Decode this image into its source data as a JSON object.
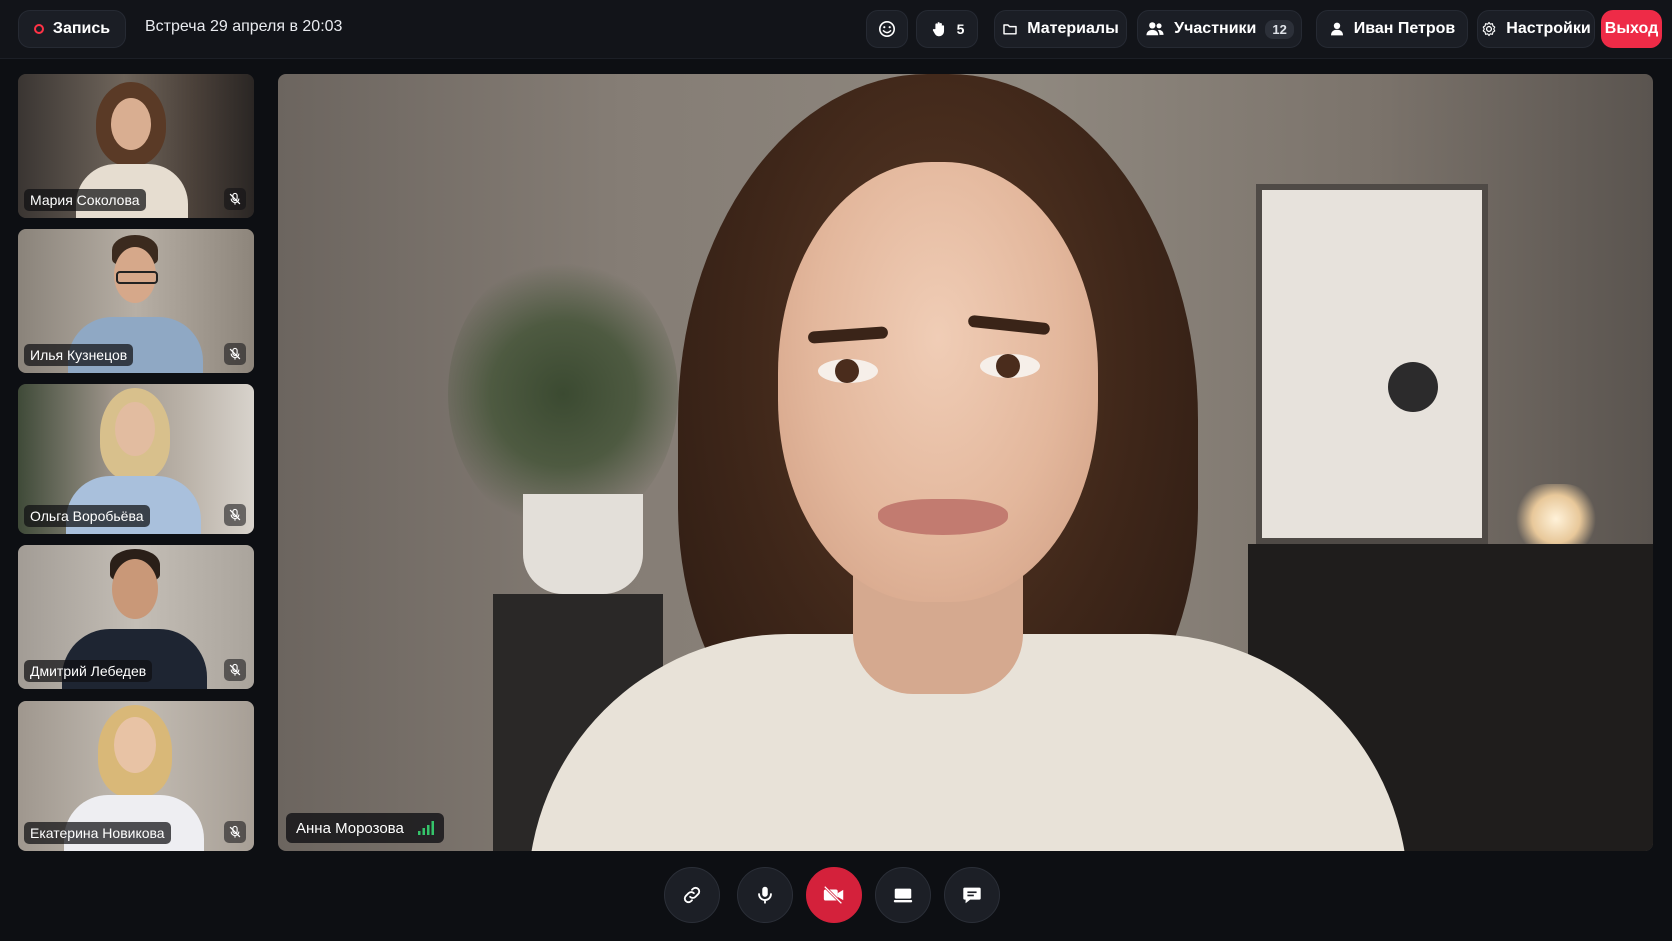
{
  "topbar": {
    "record_label": "Запись",
    "meeting_title": "Встреча 29 апреля в 20:03",
    "emoji_icon": "smiley-icon",
    "raised_hands_count": "5",
    "materials_label": "Материалы",
    "participants_label": "Участники",
    "participants_count": "12",
    "user_name": "Иван Петров",
    "settings_label": "Настройки",
    "exit_label": "Выход"
  },
  "participants": [
    {
      "name": "Мария Соколова",
      "muted": true
    },
    {
      "name": "Илья Кузнецов",
      "muted": true
    },
    {
      "name": "Ольга Воробьёва",
      "muted": true
    },
    {
      "name": "Дмитрий Лебедев",
      "muted": true
    },
    {
      "name": "Екатерина Новикова",
      "muted": true
    }
  ],
  "main_speaker": {
    "name": "Анна Морозова",
    "signal_icon": "signal-strength-icon"
  },
  "controls": [
    {
      "icon": "link-icon"
    },
    {
      "icon": "microphone-icon"
    },
    {
      "icon": "camera-off-icon",
      "active_color": "#d4213b"
    },
    {
      "icon": "screen-share-icon"
    },
    {
      "icon": "chat-icon"
    }
  ],
  "colors": {
    "accent_red": "#ee2b47",
    "background": "#0d0f13",
    "signal_green": "#35c46a"
  }
}
